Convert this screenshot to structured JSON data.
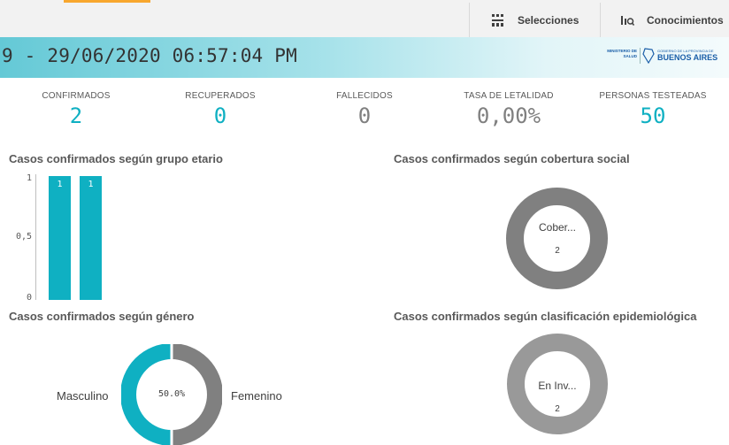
{
  "toolbar": {
    "selecciones_label": "Selecciones",
    "conocimientos_label": "Conocimientos"
  },
  "header": {
    "datetime": "9 - 29/06/2020 06:57:04 PM",
    "logo_ministerio": "MINISTERIO DE SALUD",
    "logo_gobierno": "GOBIERNO DE LA PROVINCIA DE",
    "logo_provincia": "BUENOS AIRES"
  },
  "kpis": [
    {
      "label": "CONFIRMADOS",
      "value": "2",
      "color": "#0fb0c2"
    },
    {
      "label": "RECUPERADOS",
      "value": "0",
      "color": "#0fb0c2"
    },
    {
      "label": "FALLECIDOS",
      "value": "0",
      "color": "#808080"
    },
    {
      "label": "TASA DE LETALIDAD",
      "value": "0,00%",
      "color": "#808080"
    },
    {
      "label": "PERSONAS TESTEADAS",
      "value": "50",
      "color": "#0fb0c2"
    }
  ],
  "charts": {
    "grupo_etario": {
      "title": "Casos confirmados según grupo etario"
    },
    "cobertura_social": {
      "title": "Casos confirmados según cobertura social",
      "label": "Cober...",
      "count": "2"
    },
    "genero": {
      "title": "Casos confirmados según género",
      "left_label": "Masculino",
      "right_label": "Femenino",
      "center_pct": "50.0%"
    },
    "clasificacion": {
      "title": "Casos confirmados según clasificación epidemiológica",
      "label": "En Inv...",
      "count": "2"
    }
  },
  "chart_data": [
    {
      "type": "bar",
      "title": "Casos confirmados según grupo etario",
      "categories": [
        "",
        ""
      ],
      "values": [
        1,
        1
      ],
      "yticks": [
        "0",
        "0,5",
        "1"
      ],
      "ylim": [
        0,
        1
      ],
      "color": "#0fb0c2"
    },
    {
      "type": "pie",
      "title": "Casos confirmados según cobertura social",
      "labels": [
        "Cober..."
      ],
      "values": [
        2
      ],
      "color": "#808080"
    },
    {
      "type": "pie",
      "title": "Casos confirmados según género",
      "labels": [
        "Masculino",
        "Femenino"
      ],
      "values": [
        1,
        1
      ],
      "colors": [
        "#0fb0c2",
        "#808080"
      ]
    },
    {
      "type": "pie",
      "title": "Casos confirmados según clasificación epidemiológica",
      "labels": [
        "En Inv..."
      ],
      "values": [
        2
      ],
      "color": "#999999"
    }
  ]
}
